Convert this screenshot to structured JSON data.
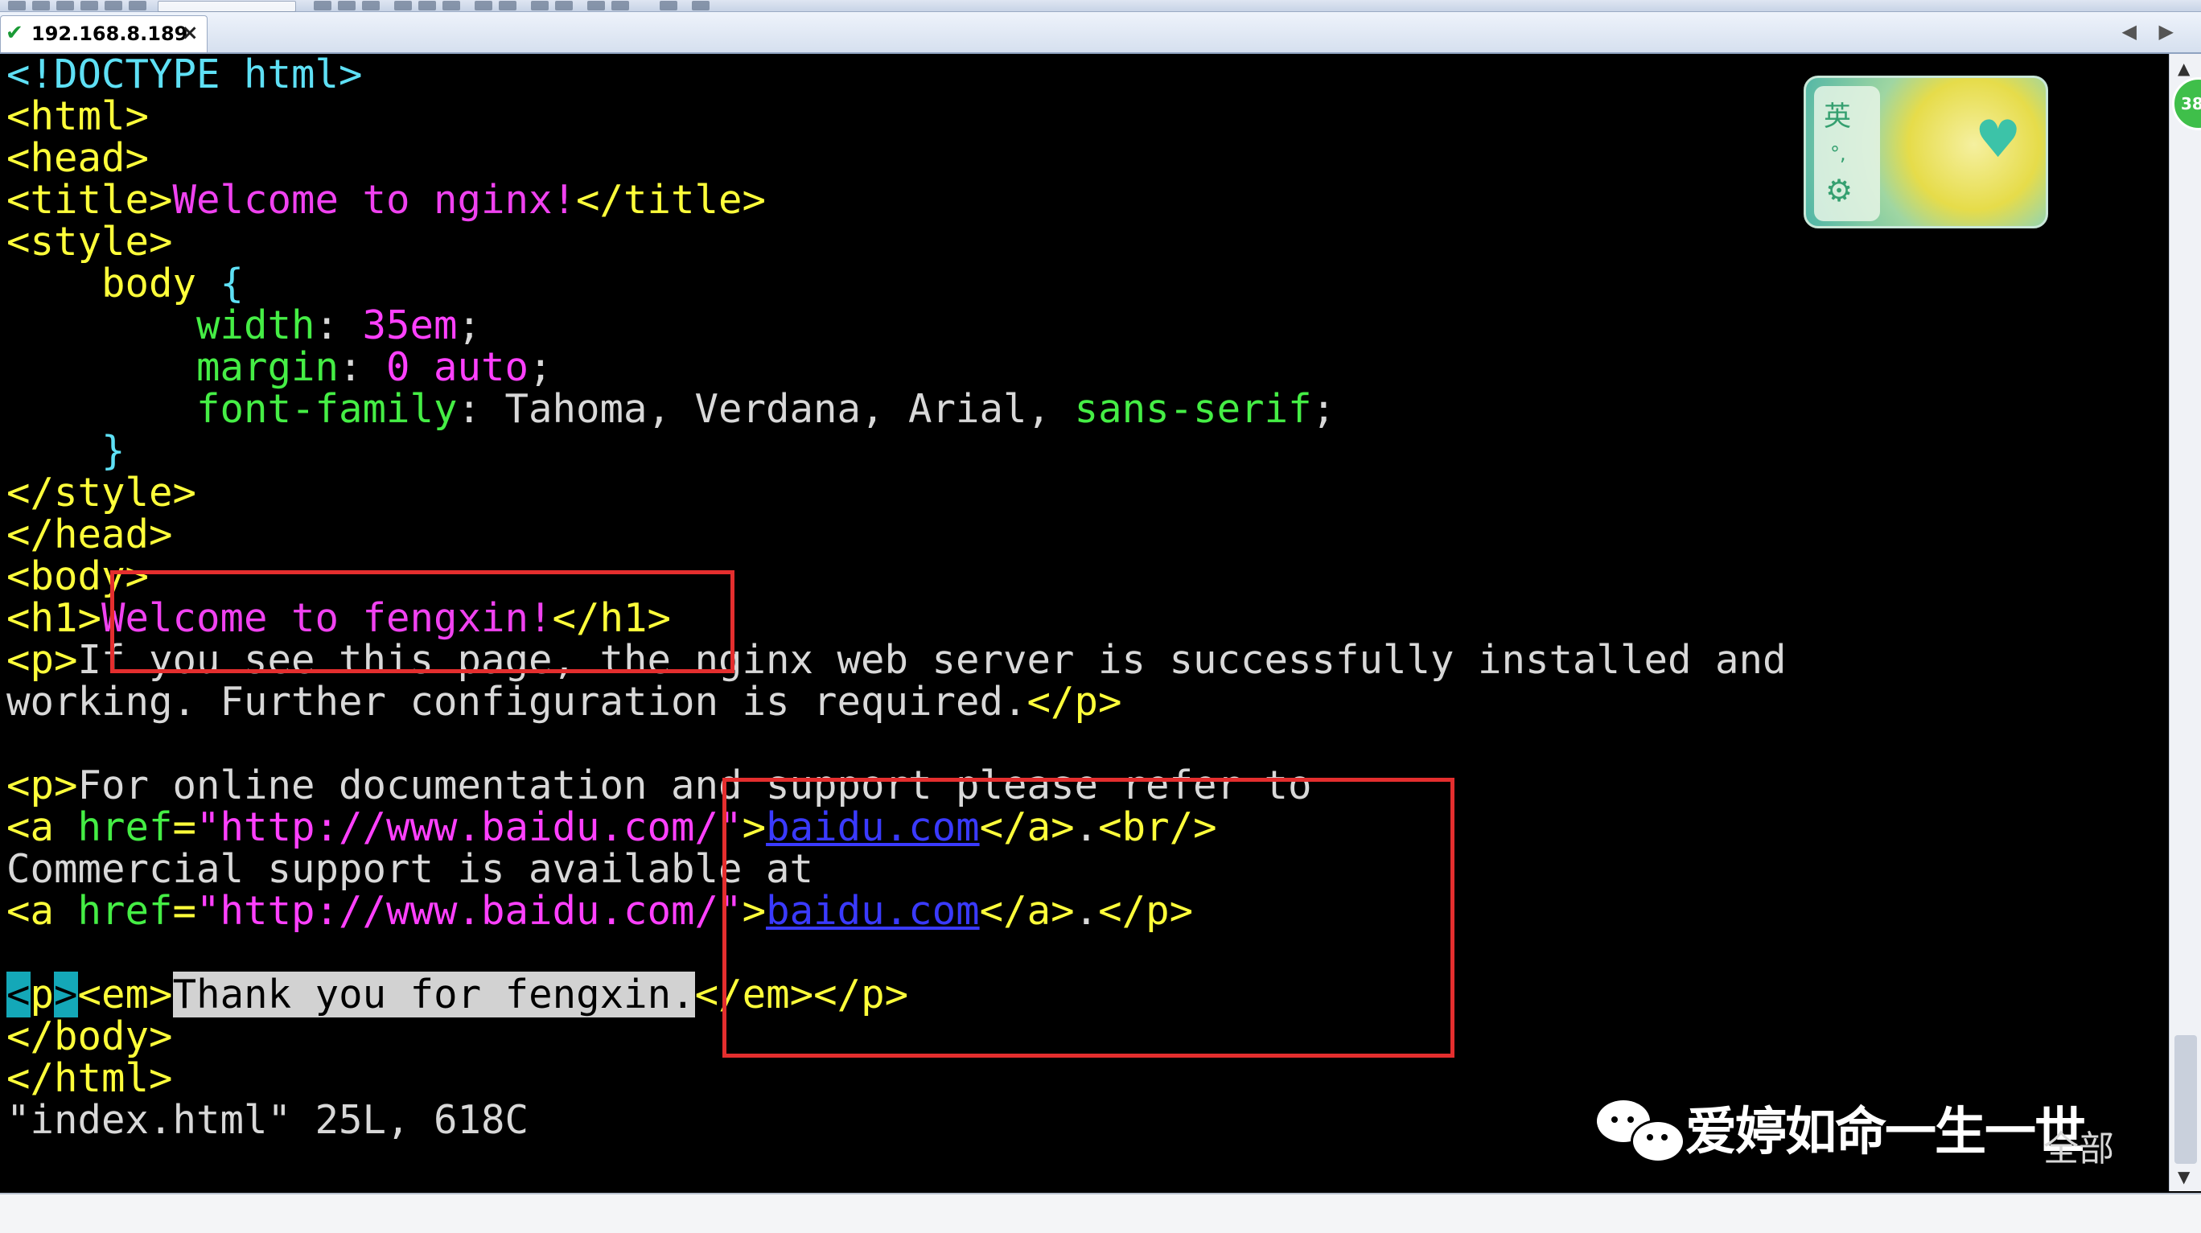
{
  "tab": {
    "host": "192.168.8.189",
    "close": "×"
  },
  "tab_nav": "◀ ▶",
  "ime": {
    "lang": "英",
    "punct": "°,",
    "settings": "⚙"
  },
  "badge": "38",
  "terminal": {
    "l1": {
      "open": "<!DOCTYPE html>"
    },
    "l2": {
      "tag": "<html>"
    },
    "l3": {
      "tag": "<head>"
    },
    "l4": {
      "open": "<title>",
      "text": "Welcome to nginx!",
      "close": "</title>"
    },
    "l5": {
      "tag": "<style>"
    },
    "l6": {
      "indent": "    ",
      "sel": "body",
      "brace": " {"
    },
    "l7": {
      "indent": "        ",
      "prop": "width",
      "colon": ": ",
      "val": "35em",
      "semi": ";"
    },
    "l8": {
      "indent": "        ",
      "prop": "margin",
      "colon": ": ",
      "val": "0 auto",
      "semi": ";"
    },
    "l9": {
      "indent": "        ",
      "prop": "font-family",
      "colon": ": ",
      "val": "Tahoma, Verdana, Arial, ",
      "val2": "sans-serif",
      "semi": ";"
    },
    "l10": {
      "indent": "    ",
      "brace": "}"
    },
    "l11": {
      "tag": "</style>"
    },
    "l12": {
      "tag": "</head>"
    },
    "l13": {
      "tag": "<body>"
    },
    "l14": {
      "open": "<h1>",
      "text": "Welcome to fengxin!",
      "close": "</h1>"
    },
    "l15": {
      "open": "<p>",
      "text": "If you see this page, the nginx web server is successfully installed and"
    },
    "l16": {
      "text": "working. Further configuration is required.",
      "close": "</p>"
    },
    "l18": {
      "open": "<p>",
      "text": "For online documentation and support please refer to"
    },
    "l19": {
      "open": "<a ",
      "attr": "href",
      "eq": "=",
      "val": "\"http://www.baidu.com/\"",
      "gt": ">",
      "link": "baidu.com",
      "close": "</a>",
      "dot": ".",
      "br": "<br/>"
    },
    "l20": {
      "text": "Commercial support is available at"
    },
    "l21": {
      "open": "<a ",
      "attr": "href",
      "eq": "=",
      "val": "\"http://www.baidu.com/\"",
      "gt": ">",
      "link": "baidu.com",
      "close": "</a>",
      "dot": ".",
      "pclose": "</p>"
    },
    "l23": {
      "lt": "<",
      "p": "p",
      "gt": ">",
      "em": "<em>",
      "text": "Thank you for fengxin.",
      "close": "</em></p>"
    },
    "l24": {
      "tag": "</body>"
    },
    "l25": {
      "tag": "</html>"
    },
    "status": "\"index.html\" 25L, 618C"
  },
  "watermark": {
    "text": "爱婷如命一生一世",
    "extra": "全部"
  }
}
